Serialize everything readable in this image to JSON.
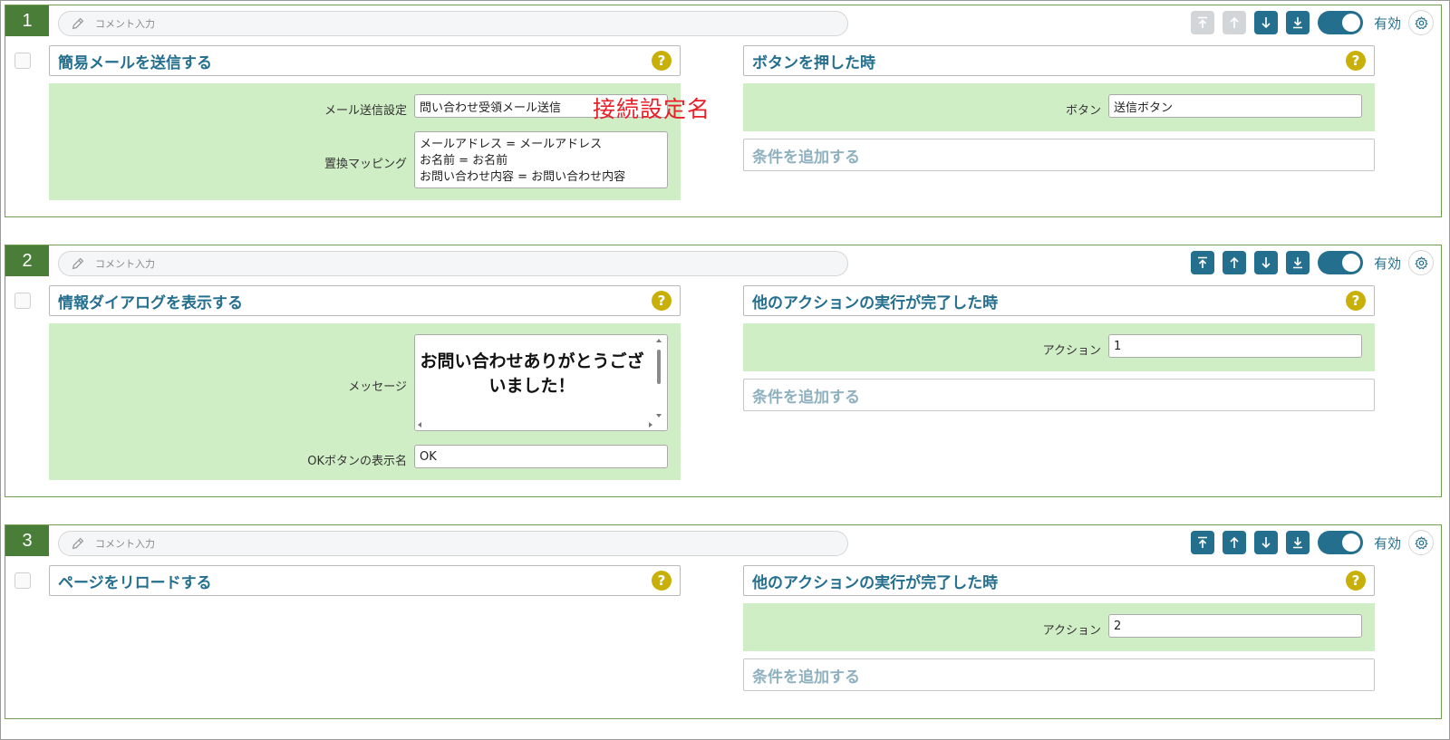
{
  "comment_placeholder": "コメント入力",
  "enabled_label": "有効",
  "annotation": "接続設定名",
  "blocks": [
    {
      "number": "1",
      "action_title": "簡易メールを送信する",
      "mail_setting_label": "メール送信設定",
      "mail_setting_value": "問い合わせ受領メール送信",
      "mapping_label": "置換マッピング",
      "mapping_value": "メールアドレス = メールアドレス\nお名前 = お名前\nお問い合わせ内容 = お問い合わせ内容",
      "trigger_title": "ボタンを押した時",
      "trigger_field_label": "ボタン",
      "trigger_field_value": "送信ボタン",
      "add_condition": "条件を追加する",
      "move_top_disabled": true,
      "move_up_disabled": true
    },
    {
      "number": "2",
      "action_title": "情報ダイアログを表示する",
      "message_label": "メッセージ",
      "message_value": "お問い合わせありがとうございました！",
      "ok_label": "OKボタンの表示名",
      "ok_value": "OK",
      "trigger_title": "他のアクションの実行が完了した時",
      "trigger_field_label": "アクション",
      "trigger_field_value": "1",
      "add_condition": "条件を追加する",
      "move_top_disabled": false,
      "move_up_disabled": false
    },
    {
      "number": "3",
      "action_title": "ページをリロードする",
      "trigger_title": "他のアクションの実行が完了した時",
      "trigger_field_label": "アクション",
      "trigger_field_value": "2",
      "add_condition": "条件を追加する",
      "move_top_disabled": false,
      "move_up_disabled": false
    }
  ],
  "icons": [
    "pencil-icon",
    "move-top-icon",
    "move-up-icon",
    "move-down-icon",
    "move-bottom-icon",
    "toggle-switch",
    "gear-icon",
    "help-icon"
  ],
  "colors": {
    "accent": "#246f8e",
    "badge": "#4a7d38",
    "green_bg": "#d0eec6",
    "help": "#c9b009",
    "annotation": "#e8202a"
  }
}
